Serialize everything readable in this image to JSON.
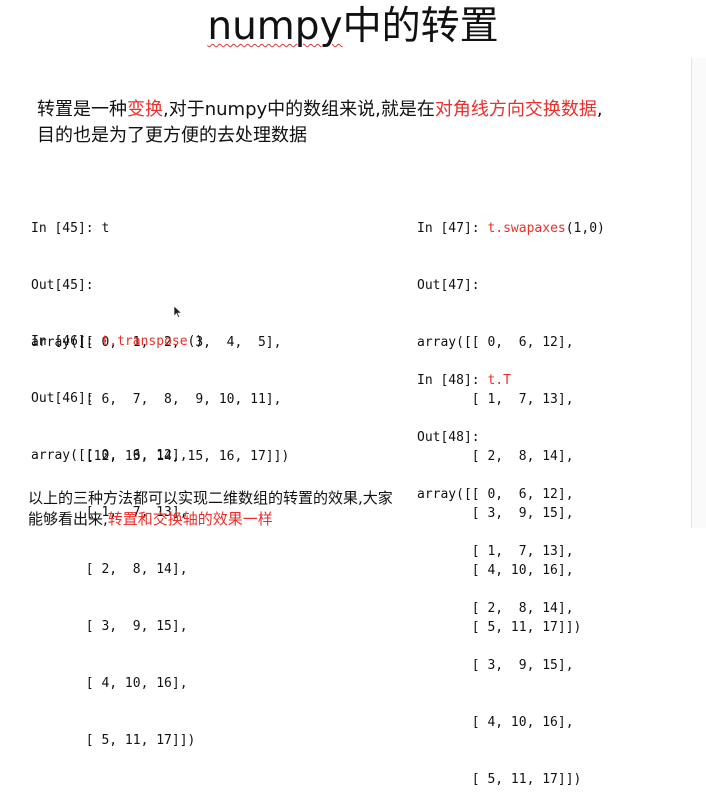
{
  "title": {
    "part1": "numpy",
    "part2": "中的转置"
  },
  "intro": {
    "l1_a": "转置是一种",
    "l1_hl1": "变换",
    "l1_b": ",对于numpy中的数组来说,就是在",
    "l1_hl2": "对角线方向交换数据",
    "l1_c": ",",
    "line2": "目的也是为了更方便的去处理数据"
  },
  "cells": {
    "c1": {
      "in_prompt": "In [45]: ",
      "in_code": "t",
      "in_suffix": "",
      "out": "Out[45]:",
      "rows": [
        "array([[ 0,  1,  2,  3,  4,  5],",
        "       [ 6,  7,  8,  9, 10, 11],",
        "       [12, 13, 14, 15, 16, 17]])"
      ]
    },
    "c2": {
      "in_prompt": "In [46]: ",
      "in_code": "t.transpose",
      "in_suffix": "()",
      "out": "Out[46]:",
      "rows": [
        "array([[ 0,  6, 12],",
        "       [ 1,  7, 13],",
        "       [ 2,  8, 14],",
        "       [ 3,  9, 15],",
        "       [ 4, 10, 16],",
        "       [ 5, 11, 17]])"
      ]
    },
    "c3": {
      "in_prompt": "In [47]: ",
      "in_code": "t.swapaxes",
      "in_suffix": "(1,0)",
      "out": "Out[47]:",
      "rows": [
        "array([[ 0,  6, 12],",
        "       [ 1,  7, 13],",
        "       [ 2,  8, 14],",
        "       [ 3,  9, 15],",
        "       [ 4, 10, 16],",
        "       [ 5, 11, 17]])"
      ]
    },
    "c4": {
      "in_prompt": "In [48]: ",
      "in_code": "t.T",
      "in_suffix": "",
      "out": "Out[48]:",
      "rows": [
        "array([[ 0,  6, 12],",
        "       [ 1,  7, 13],",
        "       [ 2,  8, 14],",
        "       [ 3,  9, 15],",
        "       [ 4, 10, 16],",
        "       [ 5, 11, 17]])"
      ]
    }
  },
  "bottom": {
    "line1": "以上的三种方法都可以实现二维数组的转置的效果,大家",
    "line2_a": "能够看出来,",
    "line2_hl": "转置和交换轴的效果一样"
  },
  "colors": {
    "highlight": "#e8302e",
    "text": "#111111",
    "background": "#ffffff"
  }
}
